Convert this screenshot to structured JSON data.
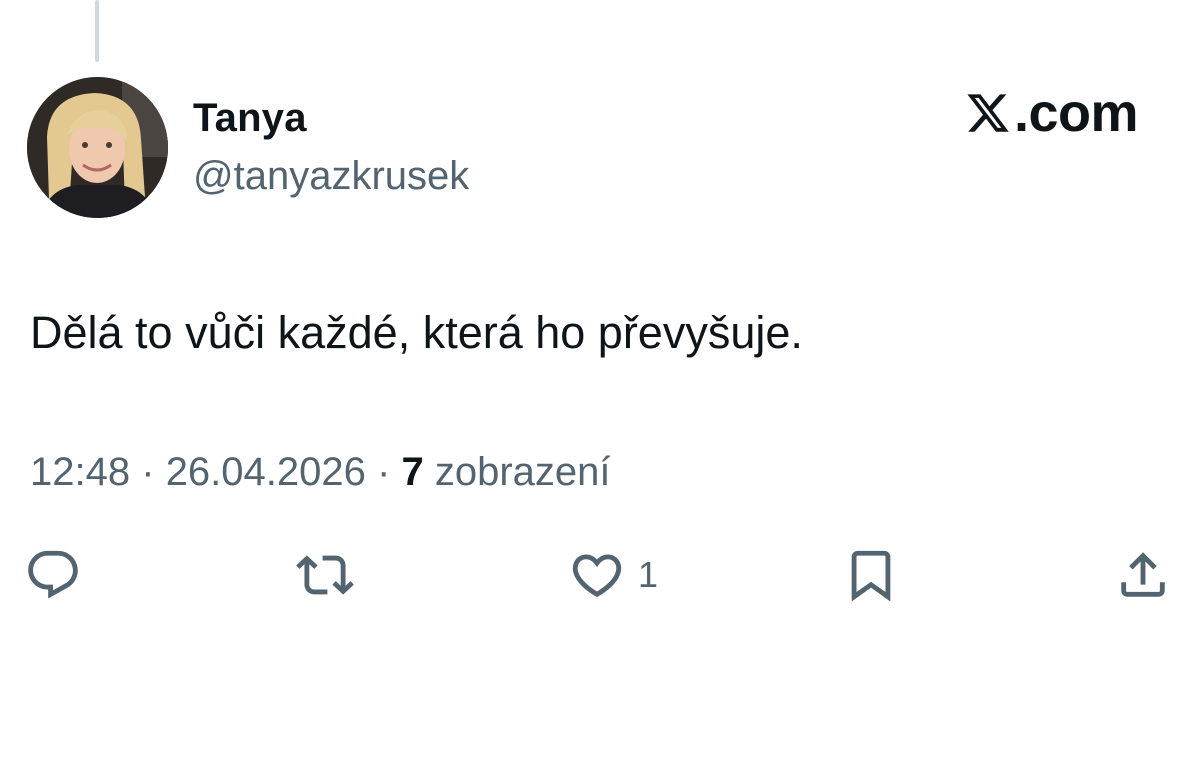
{
  "author": {
    "display_name": "Tanya",
    "handle": "@tanyazkrusek"
  },
  "brand": {
    "logo_icon": "x-logo-icon",
    "suffix": ".com"
  },
  "tweet": {
    "text": "Dělá to vůči každé, která ho převyšuje.",
    "time": "12:48",
    "separator": "·",
    "date": "26.04.2026",
    "views_count": "7",
    "views_label": "zobrazení"
  },
  "actions": {
    "reply": {
      "icon": "reply-icon",
      "count": ""
    },
    "repost": {
      "icon": "repost-icon",
      "count": ""
    },
    "like": {
      "icon": "heart-icon",
      "count": "1"
    },
    "bookmark": {
      "icon": "bookmark-icon",
      "count": ""
    },
    "share": {
      "icon": "share-icon",
      "count": ""
    }
  },
  "colors": {
    "text_primary": "#0f1419",
    "text_secondary": "#536471",
    "thread_line": "#cfd9de",
    "background": "#ffffff"
  }
}
